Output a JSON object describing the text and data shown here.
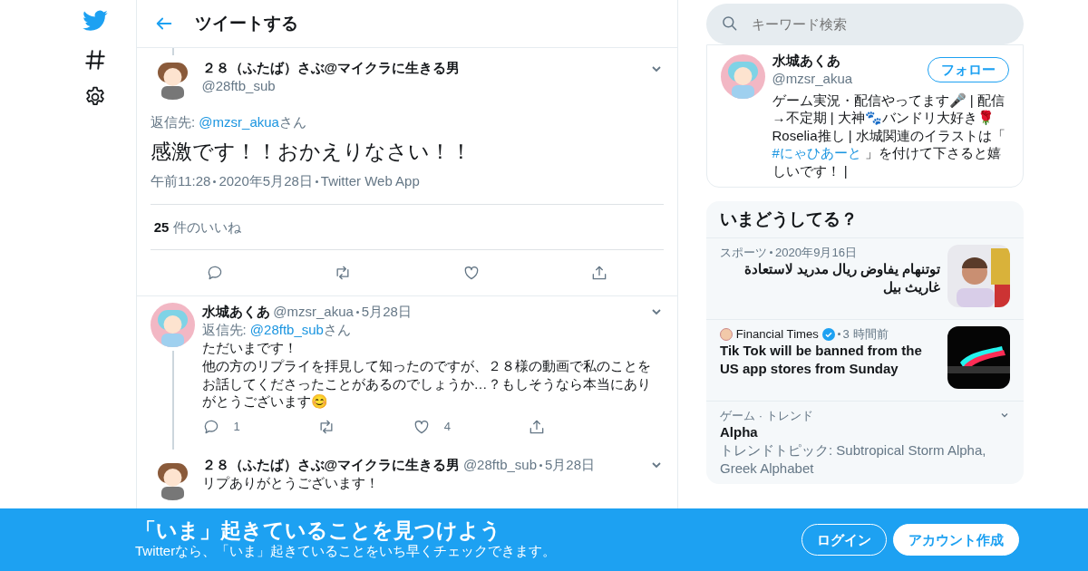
{
  "header": {
    "title": "ツイートする"
  },
  "main_tweet": {
    "name": "２８（ふたば）さぶ@マイクラに生きる男",
    "handle": "@28ftb_sub",
    "reply_prefix": "返信先: ",
    "reply_to": "@mzsr_akua",
    "reply_suffix": "さん",
    "text": "感激です！！おかえりなさい！！",
    "time": "午前11:28",
    "date": "2020年5月28日",
    "source": "Twitter Web App",
    "likes_count": "25",
    "likes_label": "件のいいね",
    "actions": [
      {
        "kind": "reply"
      },
      {
        "kind": "retweet"
      },
      {
        "kind": "like"
      },
      {
        "kind": "share"
      }
    ]
  },
  "replies": [
    {
      "name": "水城あくあ",
      "handle": "@mzsr_akua",
      "date": "5月28日",
      "reply_prefix": "返信先: ",
      "reply_to": "@28ftb_sub",
      "reply_suffix": "さん",
      "lines": [
        "ただいまです！",
        "他の方のリプライを拝見して知ったのですが、２８様の動画で私のことをお話してくださったことがあるのでしょうか…？もしそうなら本当にありがとうございます😊"
      ],
      "thread": true,
      "actions": [
        {
          "kind": "reply",
          "count": "1"
        },
        {
          "kind": "retweet"
        },
        {
          "kind": "like",
          "count": "4"
        },
        {
          "kind": "share"
        }
      ]
    },
    {
      "name": "２８（ふたば）さぶ@マイクラに生きる男",
      "handle": "@28ftb_sub",
      "date": "5月28日",
      "lines": [
        "リプありがとうございます！"
      ],
      "thread": false
    }
  ],
  "search": {
    "placeholder": "キーワード検索"
  },
  "profile": {
    "name": "水城あくあ",
    "handle": "@mzsr_akua",
    "follow": "フォロー",
    "bio_before": "ゲーム実況・配信やってます🎤 | 配信→不定期 | 大神🐾バンドリ大好き🌹Roselia推し | 水城関連のイラストは「 ",
    "hashtag": "#にゃひあーと",
    "bio_after": " 」を付けて下さると嬉しいです！ |"
  },
  "trends": {
    "title": "いまどうしてる？",
    "items": [
      {
        "kind": "news",
        "category": "スポーツ",
        "time": "2020年9月16日",
        "text": "توتنهام يفاوض ريال مدريد لاستعادة غاريث بيل"
      },
      {
        "kind": "news",
        "source": "Financial Times",
        "verified": true,
        "time": "3 時間前",
        "text": "Tik Tok will be banned from the US app stores from Sunday"
      },
      {
        "kind": "trend",
        "category": "ゲーム · トレンド",
        "title": "Alpha",
        "description": "トレンドトピック: Subtropical Storm Alpha, Greek Alphabet"
      }
    ]
  },
  "banner": {
    "title": "「いま」起きていることを見つけよう",
    "subtitle": "Twitterなら、「いま」起きていることをいち早くチェックできます。",
    "login": "ログイン",
    "signup": "アカウント作成"
  }
}
